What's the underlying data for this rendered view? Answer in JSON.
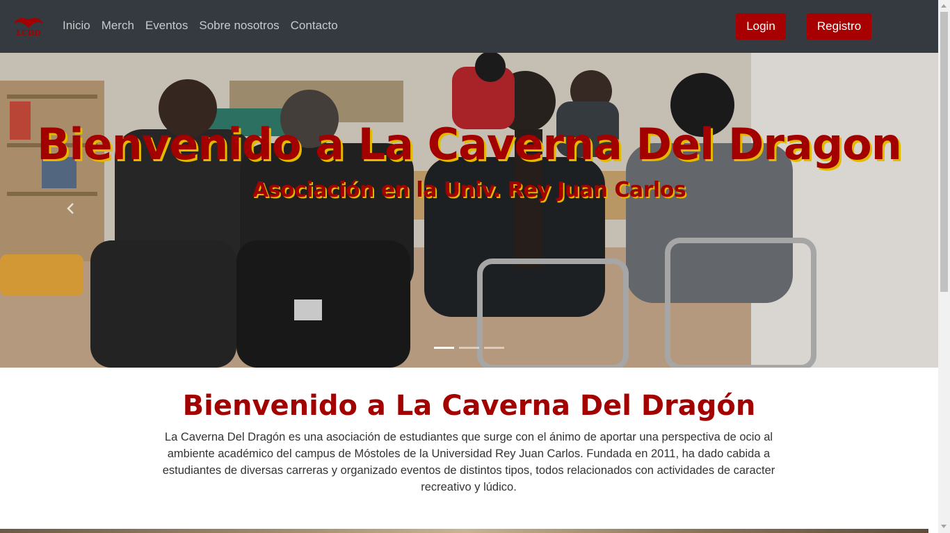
{
  "navbar": {
    "logo_icon": "dragon-logo-icon",
    "logo_text": "LCDD",
    "links": [
      "Inicio",
      "Merch",
      "Eventos",
      "Sobre nosotros",
      "Contacto"
    ],
    "login_label": "Login",
    "register_label": "Registro",
    "background": "#343a40",
    "accent": "#a80000"
  },
  "hero": {
    "title": "Bienvenido a La Caverna Del Dragon",
    "subtitle": "Asociación en la Univ. Rey Juan Carlos",
    "prev_icon": "chevron-left-icon",
    "slides": 3,
    "active_slide": 1
  },
  "main": {
    "title": "Bienvenido a La Caverna Del Dragón",
    "description": "La Caverna Del Dragón es una asociación de estudiantes que surge con el ánimo de aportar una perspectiva de ocio al ambiente académico del campus de Móstoles de la Universidad Rey Juan Carlos. Fundada en 2011, ha dado cabida a estudiantes de diversas carreras y organizado eventos de distintos tipos, todos relacionados con actividades de caracter recreativo y lúdico."
  }
}
